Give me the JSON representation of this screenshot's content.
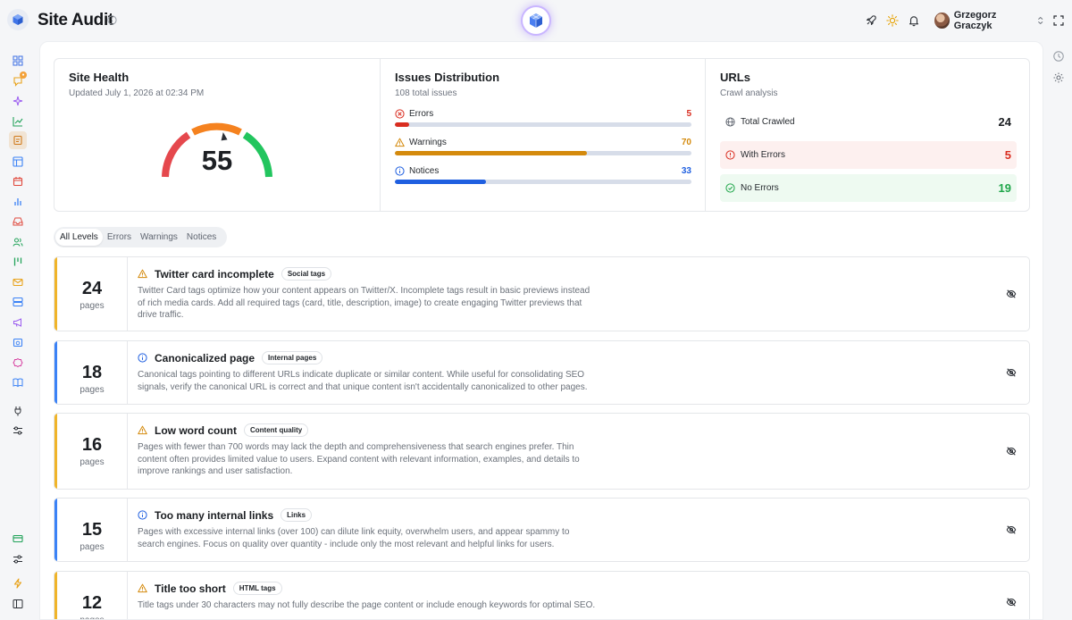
{
  "header": {
    "title": "Site Audit",
    "user_name": "Grzegorz Graczyk"
  },
  "site_health": {
    "title": "Site Health",
    "updated": "Updated July 1, 2026 at 02:34 PM",
    "score": "55"
  },
  "issues_distribution": {
    "title": "Issues Distribution",
    "subtitle": "108 total issues",
    "rows": [
      {
        "label": "Errors",
        "count": "5",
        "fraction": 0.048,
        "color": "#d92d20"
      },
      {
        "label": "Warnings",
        "count": "70",
        "fraction": 0.648,
        "color": "#d48a0d"
      },
      {
        "label": "Notices",
        "count": "33",
        "fraction": 0.306,
        "color": "#1f5fe0"
      }
    ]
  },
  "urls": {
    "title": "URLs",
    "subtitle": "Crawl analysis",
    "rows": [
      {
        "label": "Total Crawled",
        "value": "24"
      },
      {
        "label": "With Errors",
        "value": "5"
      },
      {
        "label": "No Errors",
        "value": "19"
      }
    ]
  },
  "filters": [
    "All Levels",
    "Errors",
    "Warnings",
    "Notices"
  ],
  "issues": [
    {
      "count": "24",
      "unit": "pages",
      "level": "warning",
      "title": "Twitter card incomplete",
      "tag": "Social tags",
      "desc": "Twitter Card tags optimize how your content appears on Twitter/X. Incomplete tags result in basic previews instead of rich media cards. Add all required tags (card, title, description, image) to create engaging Twitter previews that drive traffic."
    },
    {
      "count": "18",
      "unit": "pages",
      "level": "notice",
      "title": "Canonicalized page",
      "tag": "Internal pages",
      "desc": "Canonical tags pointing to different URLs indicate duplicate or similar content. While useful for consolidating SEO signals, verify the canonical URL is correct and that unique content isn't accidentally canonicalized to other pages."
    },
    {
      "count": "16",
      "unit": "pages",
      "level": "warning",
      "title": "Low word count",
      "tag": "Content quality",
      "desc": "Pages with fewer than 700 words may lack the depth and comprehensiveness that search engines prefer. Thin content often provides limited value to users. Expand content with relevant information, examples, and details to improve rankings and user satisfaction."
    },
    {
      "count": "15",
      "unit": "pages",
      "level": "notice",
      "title": "Too many internal links",
      "tag": "Links",
      "desc": "Pages with excessive internal links (over 100) can dilute link equity, overwhelm users, and appear spammy to search engines. Focus on quality over quantity - include only the most relevant and helpful links for users."
    },
    {
      "count": "12",
      "unit": "pages",
      "level": "warning",
      "title": "Title too short",
      "tag": "HTML tags",
      "desc": "Title tags under 30 characters may not fully describe the page content or include enough keywords for optimal SEO."
    }
  ],
  "colors": {
    "warning": "#f0b429",
    "notice": "#3b82f6",
    "error": "#d92d20",
    "success": "#1fa64a"
  }
}
